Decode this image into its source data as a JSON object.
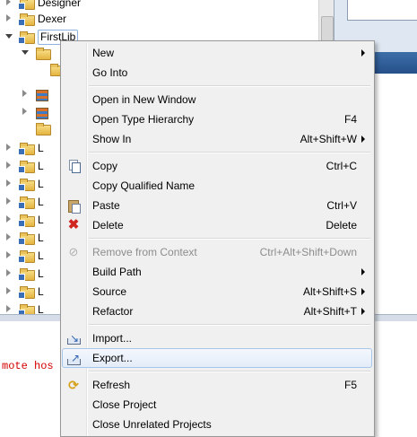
{
  "tree": {
    "items": [
      {
        "label": "Designer",
        "state": "closed",
        "depth": 0
      },
      {
        "label": "Dexer",
        "state": "closed",
        "depth": 0
      },
      {
        "label": "FirstLib",
        "state": "open",
        "depth": 0,
        "selected": true
      },
      {
        "label": "",
        "state": "open",
        "depth": 1
      },
      {
        "label": "",
        "state": "none",
        "depth": 2
      },
      {
        "label": "",
        "state": "closed",
        "depth": 1
      },
      {
        "label": "",
        "state": "closed",
        "depth": 1
      },
      {
        "label": "",
        "state": "none",
        "depth": 1
      },
      {
        "label": "L",
        "state": "closed",
        "depth": 0
      },
      {
        "label": "L",
        "state": "closed",
        "depth": 0
      },
      {
        "label": "L",
        "state": "closed",
        "depth": 0
      },
      {
        "label": "L",
        "state": "closed",
        "depth": 0
      },
      {
        "label": "L",
        "state": "closed",
        "depth": 0
      },
      {
        "label": "L",
        "state": "closed",
        "depth": 0
      },
      {
        "label": "L",
        "state": "closed",
        "depth": 0
      },
      {
        "label": "L",
        "state": "closed",
        "depth": 0
      },
      {
        "label": "L",
        "state": "closed",
        "depth": 0
      },
      {
        "label": "L",
        "state": "closed",
        "depth": 0
      },
      {
        "label": "L",
        "state": "closed",
        "depth": 0
      }
    ]
  },
  "console": {
    "text": "mote hos"
  },
  "context_menu": {
    "items": [
      {
        "type": "item",
        "label": "New",
        "shortcut": "",
        "submenu": true,
        "icon": ""
      },
      {
        "type": "item",
        "label": "Go Into",
        "shortcut": "",
        "submenu": false,
        "icon": ""
      },
      {
        "type": "separator"
      },
      {
        "type": "item",
        "label": "Open in New Window",
        "shortcut": "",
        "submenu": false,
        "icon": ""
      },
      {
        "type": "item",
        "label": "Open Type Hierarchy",
        "shortcut": "F4",
        "submenu": false,
        "icon": ""
      },
      {
        "type": "item",
        "label": "Show In",
        "shortcut": "Alt+Shift+W",
        "submenu": true,
        "icon": ""
      },
      {
        "type": "separator"
      },
      {
        "type": "item",
        "label": "Copy",
        "shortcut": "Ctrl+C",
        "submenu": false,
        "icon": "copy-icon"
      },
      {
        "type": "item",
        "label": "Copy Qualified Name",
        "shortcut": "",
        "submenu": false,
        "icon": ""
      },
      {
        "type": "item",
        "label": "Paste",
        "shortcut": "Ctrl+V",
        "submenu": false,
        "icon": "paste-icon"
      },
      {
        "type": "item",
        "label": "Delete",
        "shortcut": "Delete",
        "submenu": false,
        "icon": "delete-icon"
      },
      {
        "type": "separator"
      },
      {
        "type": "item",
        "label": "Remove from Context",
        "shortcut": "Ctrl+Alt+Shift+Down",
        "submenu": false,
        "icon": "remove-context-icon",
        "disabled": true
      },
      {
        "type": "item",
        "label": "Build Path",
        "shortcut": "",
        "submenu": true,
        "icon": ""
      },
      {
        "type": "item",
        "label": "Source",
        "shortcut": "Alt+Shift+S",
        "submenu": true,
        "icon": ""
      },
      {
        "type": "item",
        "label": "Refactor",
        "shortcut": "Alt+Shift+T",
        "submenu": true,
        "icon": ""
      },
      {
        "type": "separator"
      },
      {
        "type": "item",
        "label": "Import...",
        "shortcut": "",
        "submenu": false,
        "icon": "import-icon"
      },
      {
        "type": "item",
        "label": "Export...",
        "shortcut": "",
        "submenu": false,
        "icon": "export-icon",
        "hover": true
      },
      {
        "type": "separator"
      },
      {
        "type": "item",
        "label": "Refresh",
        "shortcut": "F5",
        "submenu": false,
        "icon": "refresh-icon"
      },
      {
        "type": "item",
        "label": "Close Project",
        "shortcut": "",
        "submenu": false,
        "icon": ""
      },
      {
        "type": "item",
        "label": "Close Unrelated Projects",
        "shortcut": "",
        "submenu": false,
        "icon": ""
      }
    ]
  }
}
